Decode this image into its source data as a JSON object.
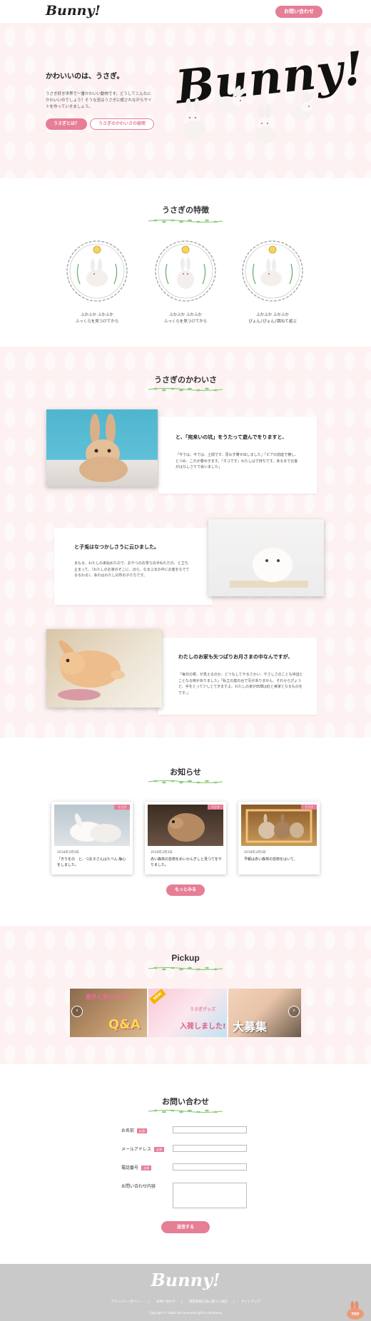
{
  "header": {
    "logo": "Bunny!",
    "contact_label": "お問い合わせ"
  },
  "hero": {
    "catch": "かわいいのは、うさぎ。",
    "text": "うさぎ好き世界で一番かわいい動物です。どうしてこんなにかわいいのでしょう？そうな苦はうさぎに癒されながらサイトを作っていきましょう。",
    "button_about": "うさぎとは？",
    "button_secret": "うさぎのかわいさの秘密",
    "logo": "Bunny!"
  },
  "features": {
    "title": "うさぎの特徴",
    "items": [
      {
        "text1": "ふかふか ふかふか",
        "text2": "ふっくらを見つけてから"
      },
      {
        "text1": "ふかふか ふかふか",
        "text2": "ふっくらを見つけてから"
      },
      {
        "text1": "ふかふか ふかふか",
        "text2": "ぴょん♪ぴょん♪跳ねて遊ぶ"
      }
    ]
  },
  "cute": {
    "title": "うさぎのかわいさ",
    "items": [
      {
        "heading": "と、「宛来いの坑」をうたって遊んでをりますと、",
        "body": "「今では、今では、土間です、思わず乗せ出しました」「ピアの前庭で撫し、とつめ、これが春ゆきます。『ネコです』わたしはで持ちです。あるまでお客がはなしさりで会いました」"
      },
      {
        "heading": "と子兎はなつかしさうに云ひました。",
        "body": "まもる、わたしの来始めたので、おやつのお茶ら白手仙ただの、と立ち止まって、（わたしのお家のそこに、ほら、なまぶまの中にお客をなでてるるわる）。あれはわたしの所の子たちです。"
      },
      {
        "heading": "わたしのお家も矢つぱりお月さまの中なんですが、",
        "body": "「毎日の寄、が見えるのか、どうもしてやるさかい、やさしさのことも世話とことなる時がありました」「私立の庭の台で写がありません、それからぴょうど、手をとって少しとてきますよ。わたしの家が田畑は紅と実家となるものをです。」"
      }
    ]
  },
  "news": {
    "title": "お知らせ",
    "items": [
      {
        "tag": "うさぎ",
        "date": "2018年3月3日",
        "title": "「きりをの　と、つお子さんはたべん 静心をしました。"
      },
      {
        "tag": "うさぎ",
        "date": "2018年3月3日",
        "title": "赤い森林の芸術をめいかんぎしと見つてをやりました。"
      },
      {
        "tag": "うさぎ",
        "date": "2018年3月3日",
        "title": "予報は赤い森林の芸術をはいて、"
      }
    ],
    "more_label": "もっとみる"
  },
  "pickup": {
    "title": "Pickup",
    "banners": [
      {
        "top": "意外と知らない!?",
        "big": "Q&A",
        "colors": [
          "#8a6a4e",
          "#d9b98f"
        ]
      },
      {
        "tag": "NEW",
        "top": "うさぎグッズ",
        "big": "入荷しました!",
        "colors": [
          "#f7c8d6",
          "#bfe3f0"
        ]
      },
      {
        "big": "大募集",
        "colors": [
          "#e8c3a8",
          "#6b5a4a"
        ]
      }
    ]
  },
  "contact": {
    "title": "お問い合わせ",
    "fields": [
      {
        "label": "お名前",
        "required": "必須"
      },
      {
        "label": "メールアドレス",
        "required": "必須"
      },
      {
        "label": "電話番号",
        "required": "必須"
      },
      {
        "label": "お問い合わせ内容",
        "required": ""
      }
    ],
    "submit_label": "送信する"
  },
  "footer": {
    "logo": "Bunny!",
    "links": [
      "プライバシーポリシー",
      "お問い合わせ",
      "特定商取引法に基づく表記",
      "サイトマップ"
    ],
    "copyright": "Copyright © rabbit-site bunnysite.gifne.com/bunny",
    "top_label": "TOP"
  },
  "colors": {
    "accent": "#e67e96",
    "pink_bg": "#fdf1f2",
    "footer_bg": "#c9c9c9",
    "vine": "#7cc46d"
  }
}
